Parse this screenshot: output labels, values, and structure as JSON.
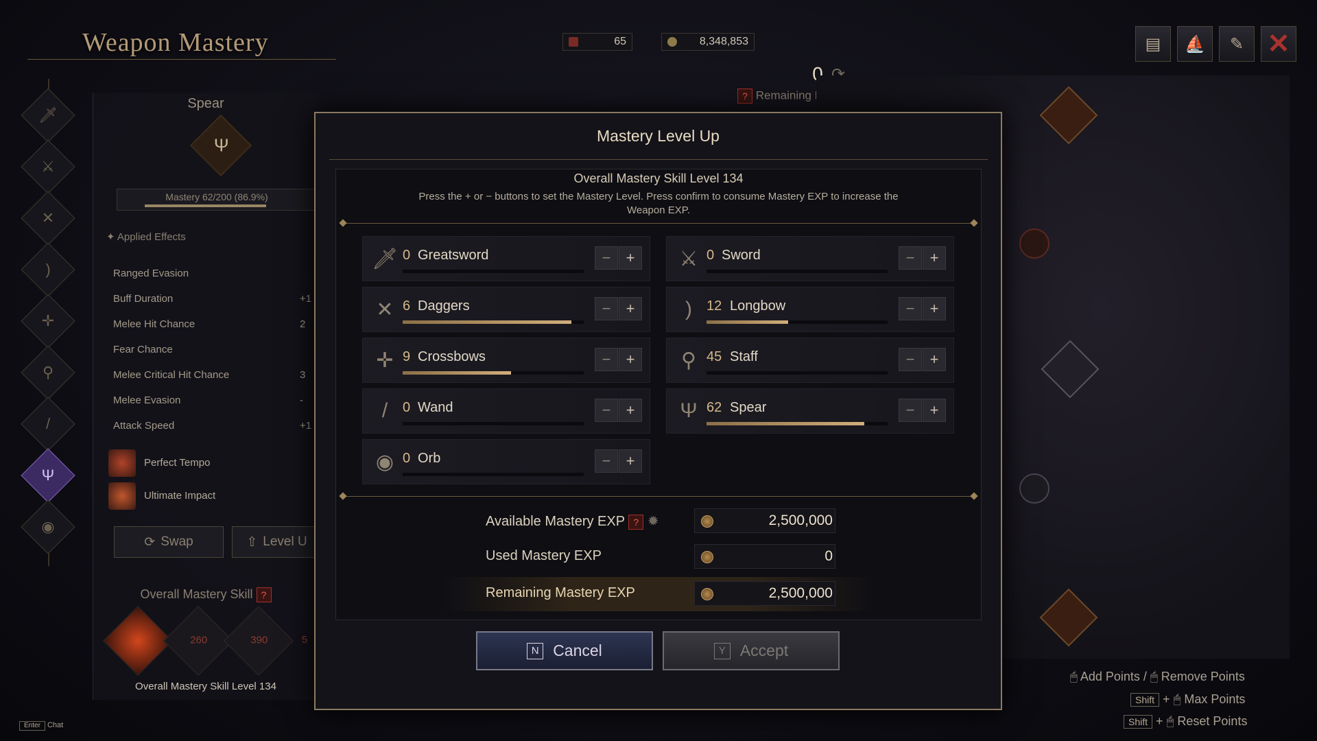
{
  "header": {
    "title": "Weapon Mastery",
    "currency1": "65",
    "currency2": "8,348,853",
    "remaining_points_value": "0",
    "remaining_points_label": "Remaining Mastery Poin"
  },
  "left_panel": {
    "weapon_name": "Spear",
    "mastery_bar": "Mastery 62/200 (86.9%)",
    "mastery_progress": 0.869,
    "applied_effects": "Applied Effects",
    "stats": [
      {
        "label": "Ranged Evasion",
        "value": ""
      },
      {
        "label": "Buff Duration",
        "value": "+1"
      },
      {
        "label": "Melee Hit Chance",
        "value": "2"
      },
      {
        "label": "Fear Chance",
        "value": ""
      },
      {
        "label": "Melee Critical Hit Chance",
        "value": "3"
      },
      {
        "label": "Melee Evasion",
        "value": "-"
      },
      {
        "label": "Attack Speed",
        "value": "+1"
      }
    ],
    "perks": [
      "Perfect Tempo",
      "Ultimate Impact"
    ],
    "swap_label": "Swap",
    "levelup_label": "Level U",
    "overall_skill_title": "Overall Mastery Skill",
    "skill_nodes": [
      "260",
      "390",
      "5"
    ],
    "overall_skill_level": "Overall Mastery Skill Level 134"
  },
  "modal": {
    "title": "Mastery Level Up",
    "overall_level": "Overall Mastery Skill Level 134",
    "description": "Press the + or − buttons to set the Mastery Level. Press confirm to consume Mastery EXP to increase the Weapon EXP.",
    "weapons": [
      {
        "level": "0",
        "name": "Greatsword",
        "icon": "greatsword-icon",
        "progress": 0.0
      },
      {
        "level": "0",
        "name": "Sword",
        "icon": "sword-icon",
        "progress": 0.0
      },
      {
        "level": "6",
        "name": "Daggers",
        "icon": "daggers-icon",
        "progress": 0.93
      },
      {
        "level": "12",
        "name": "Longbow",
        "icon": "longbow-icon",
        "progress": 0.45
      },
      {
        "level": "9",
        "name": "Crossbows",
        "icon": "crossbow-icon",
        "progress": 0.6
      },
      {
        "level": "45",
        "name": "Staff",
        "icon": "staff-icon",
        "progress": 0.0
      },
      {
        "level": "0",
        "name": "Wand",
        "icon": "wand-icon",
        "progress": 0.0
      },
      {
        "level": "62",
        "name": "Spear",
        "icon": "spear-icon",
        "progress": 0.87
      },
      {
        "level": "0",
        "name": "Orb",
        "icon": "orb-icon",
        "progress": 0.0
      }
    ],
    "exp": {
      "available_label": "Available Mastery EXP",
      "available_value": "2,500,000",
      "used_label": "Used Mastery EXP",
      "used_value": "0",
      "remaining_label": "Remaining Mastery EXP",
      "remaining_value": "2,500,000"
    },
    "cancel_key": "N",
    "cancel_label": "Cancel",
    "accept_key": "Y",
    "accept_label": "Accept"
  },
  "hints": {
    "add": "Add Points",
    "slash": "/",
    "remove": "Remove Points",
    "shift": "Shift",
    "plus": "+",
    "max": "Max Points",
    "reset": "Reset Points"
  },
  "chat": {
    "key": "Enter",
    "label": "Chat"
  }
}
